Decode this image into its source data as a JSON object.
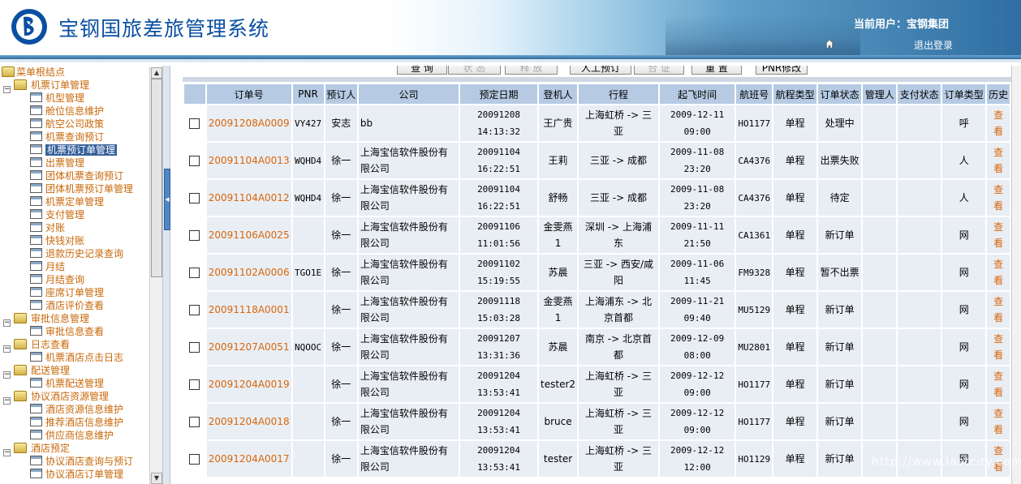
{
  "header": {
    "title": "宝钢国旅差旅管理系统",
    "current_user": "当前用户：宝钢集团",
    "logout": "退出登录"
  },
  "sidebar": {
    "root": "菜单根结点",
    "groups": [
      {
        "label": "机票订单管理",
        "items": [
          "机型管理",
          "舱位信息维护",
          "航空公司政策",
          "机票查询预订",
          "机票预订单管理",
          "出票管理",
          "团体机票查询预订",
          "团体机票预订单管理",
          "机票定单管理",
          "支付管理",
          "对账",
          "快钱对账",
          "退款历史记录查询",
          "月结",
          "月结查询",
          "座席订单管理",
          "酒店评价查看"
        ]
      },
      {
        "label": "审批信息管理",
        "items": [
          "审批信息查看"
        ]
      },
      {
        "label": "日志查看",
        "items": [
          "机票酒店点击日志"
        ]
      },
      {
        "label": "配送管理",
        "items": [
          "机票配送管理"
        ]
      },
      {
        "label": "协议酒店资源管理",
        "items": [
          "酒店资源信息维护",
          "推荐酒店信息维护",
          "供应商信息维护"
        ]
      },
      {
        "label": "酒店预定",
        "items": [
          "协议酒店查询与预订",
          "协议酒店订单管理"
        ]
      }
    ],
    "selected": "机票预订单管理"
  },
  "toolbar": {
    "buttons": [
      "查 询",
      "状 态",
      "释 放",
      "人工预订",
      "合 证",
      "重 置",
      "PNR修改"
    ]
  },
  "table": {
    "headers": [
      "",
      "订单号",
      "PNR",
      "预订人",
      "公司",
      "预定日期",
      "登机人",
      "行程",
      "起飞时间",
      "航班号",
      "航程类型",
      "订单状态",
      "管理人",
      "支付状态",
      "订单类型",
      "历史"
    ],
    "rows": [
      {
        "order": "20091208A0009",
        "pnr": "VY427",
        "booker": "安志",
        "company": "bb",
        "date": "20091208",
        "time": "14:13:32",
        "passenger": "王广贵",
        "route": "上海虹桥 -> 三亚",
        "dep_date": "2009-12-11",
        "dep_time": "09:00",
        "flight": "HO1177",
        "trip": "单程",
        "status": "处理中",
        "manager": "",
        "pay": "",
        "type": "呼",
        "history": "查看"
      },
      {
        "order": "20091104A0013",
        "pnr": "WQHD4",
        "booker": "徐一",
        "company": "上海宝信软件股份有限公司",
        "date": "20091104",
        "time": "16:22:51",
        "passenger": "王莉",
        "route": "三亚 -> 成都",
        "dep_date": "2009-11-08",
        "dep_time": "23:20",
        "flight": "CA4376",
        "trip": "单程",
        "status": "出票失败",
        "manager": "",
        "pay": "",
        "type": "人",
        "history": "查看"
      },
      {
        "order": "20091104A0012",
        "pnr": "WQHD4",
        "booker": "徐一",
        "company": "上海宝信软件股份有限公司",
        "date": "20091104",
        "time": "16:22:51",
        "passenger": "舒畅",
        "route": "三亚 -> 成都",
        "dep_date": "2009-11-08",
        "dep_time": "23:20",
        "flight": "CA4376",
        "trip": "单程",
        "status": "待定",
        "manager": "",
        "pay": "",
        "type": "人",
        "history": "查看"
      },
      {
        "order": "20091106A0025",
        "pnr": "",
        "booker": "徐一",
        "company": "上海宝信软件股份有限公司",
        "date": "20091106",
        "time": "11:01:56",
        "passenger": "金雯燕1",
        "route": "深圳 -> 上海浦东",
        "dep_date": "2009-11-11",
        "dep_time": "21:50",
        "flight": "CA1361",
        "trip": "单程",
        "status": "新订单",
        "manager": "",
        "pay": "",
        "type": "网",
        "history": "查看"
      },
      {
        "order": "20091102A0006",
        "pnr": "TGO1E",
        "booker": "徐一",
        "company": "上海宝信软件股份有限公司",
        "date": "20091102",
        "time": "15:19:55",
        "passenger": "苏晨",
        "route": "三亚 -> 西安/咸阳",
        "dep_date": "2009-11-06",
        "dep_time": "11:45",
        "flight": "FM9328",
        "trip": "单程",
        "status": "暂不出票",
        "manager": "",
        "pay": "",
        "type": "网",
        "history": "查看"
      },
      {
        "order": "20091118A0001",
        "pnr": "",
        "booker": "徐一",
        "company": "上海宝信软件股份有限公司",
        "date": "20091118",
        "time": "15:03:28",
        "passenger": "金雯燕1",
        "route": "上海浦东 -> 北京首都",
        "dep_date": "2009-11-21",
        "dep_time": "09:40",
        "flight": "MU5129",
        "trip": "单程",
        "status": "新订单",
        "manager": "",
        "pay": "",
        "type": "网",
        "history": "查看"
      },
      {
        "order": "20091207A0051",
        "pnr": "NQOOC",
        "booker": "徐一",
        "company": "上海宝信软件股份有限公司",
        "date": "20091207",
        "time": "13:31:36",
        "passenger": "苏晨",
        "route": "南京 -> 北京首都",
        "dep_date": "2009-12-09",
        "dep_time": "08:00",
        "flight": "MU2801",
        "trip": "单程",
        "status": "新订单",
        "manager": "",
        "pay": "",
        "type": "网",
        "history": "查看"
      },
      {
        "order": "20091204A0019",
        "pnr": "",
        "booker": "徐一",
        "company": "上海宝信软件股份有限公司",
        "date": "20091204",
        "time": "13:53:41",
        "passenger": "tester2",
        "route": "上海虹桥 -> 三亚",
        "dep_date": "2009-12-12",
        "dep_time": "09:00",
        "flight": "HO1177",
        "trip": "单程",
        "status": "新订单",
        "manager": "",
        "pay": "",
        "type": "网",
        "history": "查看"
      },
      {
        "order": "20091204A0018",
        "pnr": "",
        "booker": "徐一",
        "company": "上海宝信软件股份有限公司",
        "date": "20091204",
        "time": "13:53:41",
        "passenger": "bruce",
        "route": "上海虹桥 -> 三亚",
        "dep_date": "2009-12-12",
        "dep_time": "09:00",
        "flight": "HO1177",
        "trip": "单程",
        "status": "新订单",
        "manager": "",
        "pay": "",
        "type": "网",
        "history": "查看"
      },
      {
        "order": "20091204A0017",
        "pnr": "",
        "booker": "徐一",
        "company": "上海宝信软件股份有限公司",
        "date": "20091204",
        "time": "13:53:41",
        "passenger": "tester",
        "route": "上海虹桥 -> 三亚",
        "dep_date": "2009-12-12",
        "dep_time": "12:00",
        "flight": "HO1129",
        "trip": "单程",
        "status": "新订单",
        "manager": "",
        "pay": "",
        "type": "网",
        "history": "查看"
      }
    ]
  },
  "watermark": "http://www.lastcity.com",
  "colors": {
    "accent": "#d9660a",
    "header_bg": "#b6cbe3",
    "cell_bg": "#e9eef4",
    "title": "#0a4fa2",
    "selected_bg": "#35609a"
  }
}
